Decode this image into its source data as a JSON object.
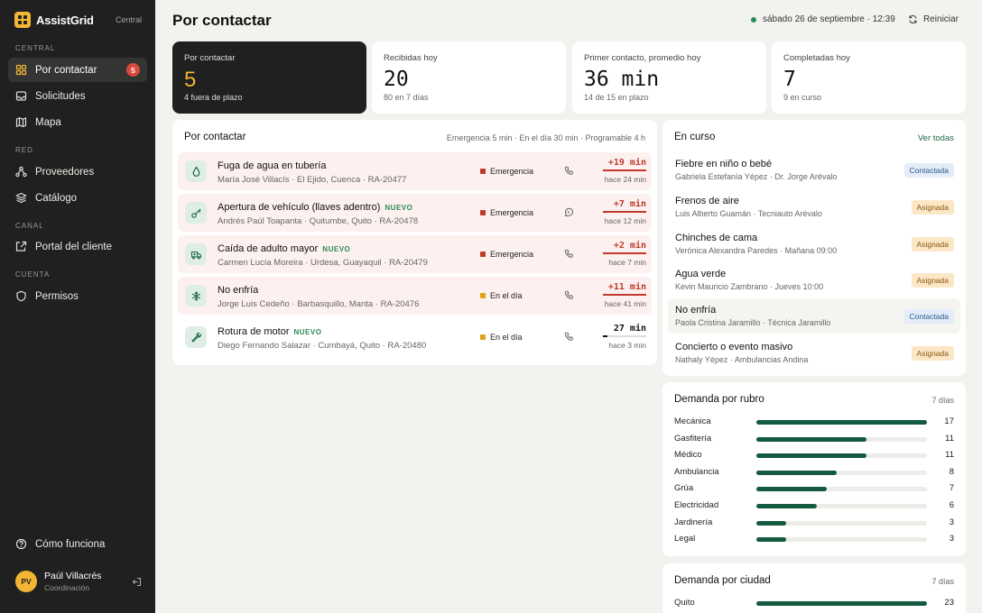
{
  "brand": {
    "name": "AssistGrid",
    "tag": "Central"
  },
  "sidebar": {
    "sections": [
      {
        "label": "CENTRAL",
        "items": [
          {
            "label": "Por contactar",
            "icon": "grid-icon",
            "badge": "5",
            "active": true
          },
          {
            "label": "Solicitudes",
            "icon": "inbox-icon"
          },
          {
            "label": "Mapa",
            "icon": "map-icon"
          }
        ]
      },
      {
        "label": "RED",
        "items": [
          {
            "label": "Proveedores",
            "icon": "network-icon"
          },
          {
            "label": "Catálogo",
            "icon": "layers-icon"
          }
        ]
      },
      {
        "label": "CANAL",
        "items": [
          {
            "label": "Portal del cliente",
            "icon": "external-link-icon"
          }
        ]
      },
      {
        "label": "CUENTA",
        "items": [
          {
            "label": "Permisos",
            "icon": "shield-icon"
          }
        ]
      }
    ],
    "help": "Cómo funciona",
    "user": {
      "initials": "PV",
      "name": "Paúl Villacrés",
      "role": "Coordinación"
    }
  },
  "header": {
    "title": "Por contactar",
    "datetime": "sábado 26 de septiembre · 12:39",
    "reset_label": "Reiniciar"
  },
  "stats": [
    {
      "label": "Por contactar",
      "value": "5",
      "sub": "4 fuera de plazo"
    },
    {
      "label": "Recibidas hoy",
      "value": "20",
      "sub": "80 en 7 días"
    },
    {
      "label": "Primer contacto, promedio hoy",
      "value": "36 min",
      "sub": "14 de 15 en plazo"
    },
    {
      "label": "Completadas hoy",
      "value": "7",
      "sub": "9 en curso"
    }
  ],
  "queue": {
    "title": "Por contactar",
    "meta": "Emergencia 5 min · En el día 30 min · Programable 4 h",
    "new_label": "NUEVO",
    "rows": [
      {
        "title": "Fuga de agua en tubería",
        "new": false,
        "sub": "María José Villacís · El Ejido, Cuenca · RA-20477",
        "priority": "Emergencia",
        "priority_color": "#c0392b",
        "channel": "phone-icon",
        "icon": "water-drop-icon",
        "time": "+19 min",
        "ago": "hace 24 min",
        "overdue": true
      },
      {
        "title": "Apertura de vehículo (llaves adentro)",
        "new": true,
        "sub": "Andrés Paúl Toapanta · Quitumbe, Quito · RA-20478",
        "priority": "Emergencia",
        "priority_color": "#c0392b",
        "channel": "whatsapp-icon",
        "icon": "car-key-icon",
        "time": "+7 min",
        "ago": "hace 12 min",
        "overdue": true
      },
      {
        "title": "Caída de adulto mayor",
        "new": true,
        "sub": "Carmen Lucía Moreira · Urdesa, Guayaquil · RA-20479",
        "priority": "Emergencia",
        "priority_color": "#c0392b",
        "channel": "phone-icon",
        "icon": "ambulance-icon",
        "time": "+2 min",
        "ago": "hace 7 min",
        "overdue": true
      },
      {
        "title": "No enfría",
        "new": false,
        "sub": "Jorge Luis Cedeño · Barbasquillo, Manta · RA-20476",
        "priority": "En el día",
        "priority_color": "#e0a21b",
        "channel": "phone-icon",
        "icon": "snowflake-icon",
        "time": "+11 min",
        "ago": "hace 41 min",
        "overdue": true
      },
      {
        "title": "Rotura de motor",
        "new": true,
        "sub": "Diego Fernando Salazar · Cumbayá, Quito · RA-20480",
        "priority": "En el día",
        "priority_color": "#e0a21b",
        "channel": "phone-icon",
        "icon": "wrench-icon",
        "time": "27 min",
        "ago": "hace 3 min",
        "overdue": false,
        "progress": 0.1
      }
    ]
  },
  "en_curso": {
    "title": "En curso",
    "link": "Ver todas",
    "items": [
      {
        "title": "Fiebre en niño o bebé",
        "sub": "Gabriela Estefanía Yépez · Dr. Jorge Arévalo",
        "status": "Contactada",
        "kind": "c"
      },
      {
        "title": "Frenos de aire",
        "sub": "Luis Alberto Guamán · Tecniauto Arévalo",
        "status": "Asignada",
        "kind": "a"
      },
      {
        "title": "Chinches de cama",
        "sub": "Verónica Alexandra Paredes · Mañana 09:00",
        "status": "Asignada",
        "kind": "a"
      },
      {
        "title": "Agua verde",
        "sub": "Kevin Mauricio Zambrano · Jueves 10:00",
        "status": "Asignada",
        "kind": "a"
      },
      {
        "title": "No enfría",
        "sub": "Paola Cristina Jaramillo · Técnica Jaramillo",
        "status": "Contactada",
        "kind": "c",
        "highlight": true
      },
      {
        "title": "Concierto o evento masivo",
        "sub": "Nathaly Yépez · Ambulancias Andina",
        "status": "Asignada",
        "kind": "a"
      }
    ]
  },
  "demanda_rubro": {
    "title": "Demanda por rubro",
    "period": "7 días",
    "max": 17,
    "items": [
      {
        "label": "Mecánica",
        "value": 17
      },
      {
        "label": "Gasfitería",
        "value": 11
      },
      {
        "label": "Médico",
        "value": 11
      },
      {
        "label": "Ambulancia",
        "value": 8
      },
      {
        "label": "Grúa",
        "value": 7
      },
      {
        "label": "Electricidad",
        "value": 6
      },
      {
        "label": "Jardinería",
        "value": 3
      },
      {
        "label": "Legal",
        "value": 3
      }
    ]
  },
  "demanda_ciudad": {
    "title": "Demanda por ciudad",
    "period": "7 días",
    "max": 23,
    "items": [
      {
        "label": "Quito",
        "value": 23
      }
    ]
  }
}
